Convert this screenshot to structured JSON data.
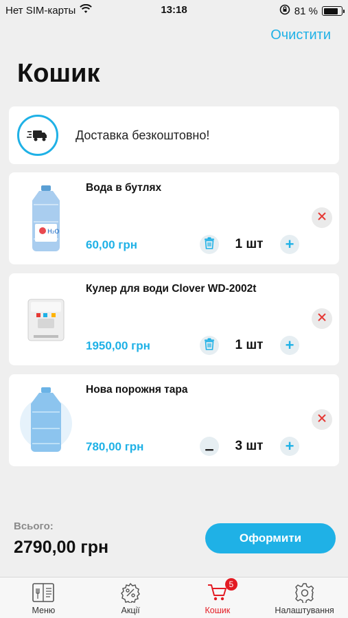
{
  "status_bar": {
    "carrier": "Нет SIM-карты",
    "time": "13:18",
    "battery": "81 %",
    "battery_level": 0.81
  },
  "header": {
    "clear_label": "Очистити",
    "title": "Кошик"
  },
  "delivery": {
    "text": "Доставка безкоштовно!",
    "icon": "truck-icon"
  },
  "items": [
    {
      "name": "Вода в бутлях",
      "price": "60,00 грн",
      "quantity": "1 шт",
      "left_control": "trash-icon"
    },
    {
      "name": "Кулер для води Clover WD-2002t",
      "price": "1950,00 грн",
      "quantity": "1 шт",
      "left_control": "trash-icon"
    },
    {
      "name": "Нова порожня тара",
      "price": "780,00 грн",
      "quantity": "3 шт",
      "left_control": "minus-icon"
    }
  ],
  "summary": {
    "total_label": "Всього:",
    "total_value": "2790,00 грн",
    "checkout_label": "Оформити"
  },
  "tabs": [
    {
      "label": "Меню",
      "icon": "menu-book-icon"
    },
    {
      "label": "Акції",
      "icon": "discount-badge-icon"
    },
    {
      "label": "Кошик",
      "icon": "cart-icon",
      "badge": "5",
      "active": true
    },
    {
      "label": "Налаштування",
      "icon": "gear-icon"
    }
  ],
  "colors": {
    "accent": "#1fb1e6",
    "active_tab": "#e31b23",
    "remove": "#e53935",
    "background": "#efefef"
  }
}
